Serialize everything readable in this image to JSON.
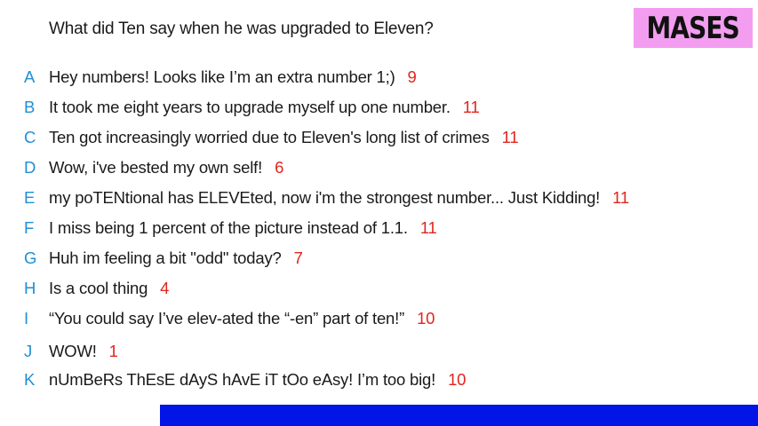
{
  "question": "What did Ten say when he was upgraded to Eleven?",
  "badge": "MASES",
  "colors": {
    "letter": "#1f8fd6",
    "votes": "#e0261f",
    "badge_bg": "#f39df0",
    "bar": "#0015e6"
  },
  "answers": [
    {
      "letter": "A",
      "text": "Hey numbers! Looks like I’m an extra number 1;)",
      "votes": "9"
    },
    {
      "letter": "B",
      "text": "It took me eight years to upgrade myself up one number.",
      "votes": "11"
    },
    {
      "letter": "C",
      "text": "Ten got increasingly worried due to Eleven's long list of crimes",
      "votes": "11"
    },
    {
      "letter": "D",
      "text": "Wow, i've bested my own self!",
      "votes": "6"
    },
    {
      "letter": "E",
      "text": "my poTENtional has ELEVEted, now i'm the strongest number... Just Kidding!",
      "votes": "11"
    },
    {
      "letter": "F",
      "text": "I miss being 1 percent of the picture instead of 1.1.",
      "votes": "11"
    },
    {
      "letter": "G",
      "text": "Huh im feeling a bit \"odd\" today?",
      "votes": "7"
    },
    {
      "letter": "H",
      "text": "Is a cool thing",
      "votes": "4"
    },
    {
      "letter": "I",
      "text": "“You could say I’ve elev-ated the “-en” part of ten!”",
      "votes": "10"
    },
    {
      "letter": "J",
      "text": "WOW!",
      "votes": "1"
    },
    {
      "letter": "K",
      "text": "nUmBeRs ThEsE dAyS hAvE iT tOo eAsy! I’m too big!",
      "votes": "10"
    }
  ]
}
